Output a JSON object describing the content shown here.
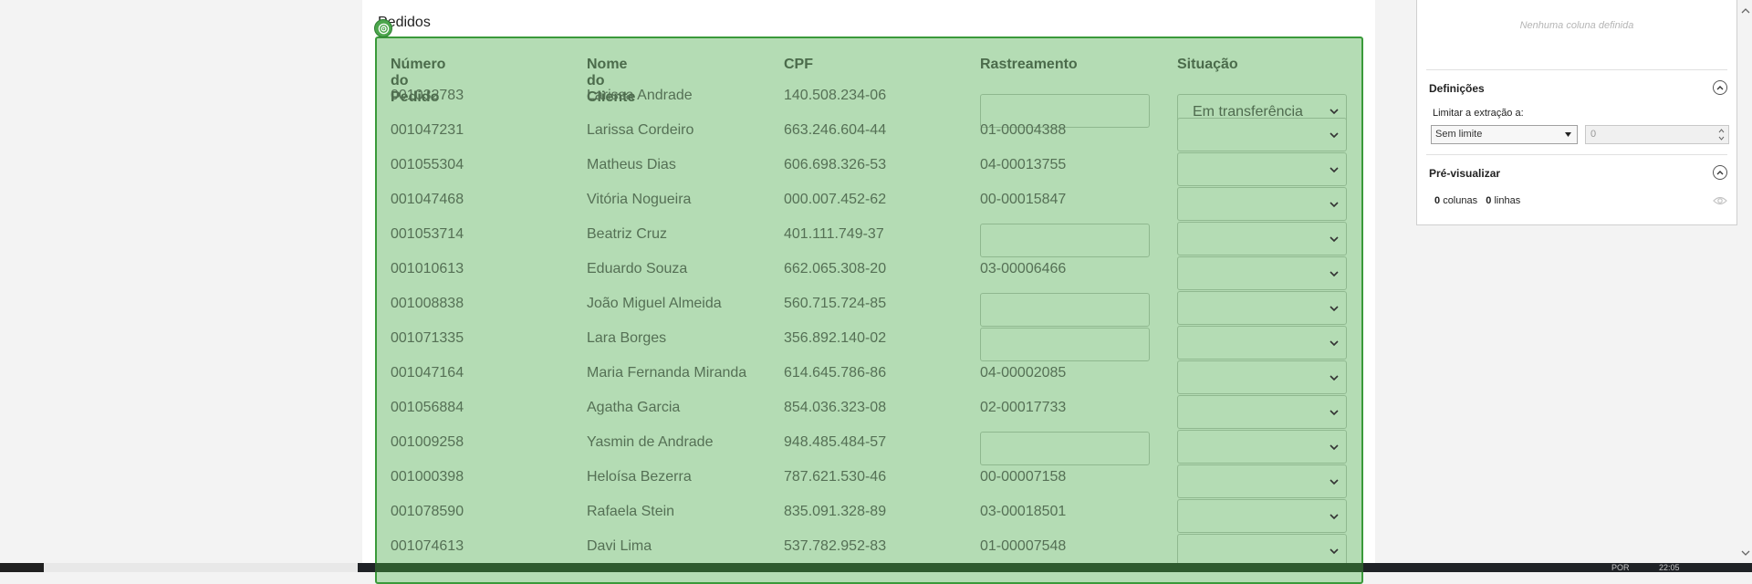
{
  "section": {
    "title": "Pedidos"
  },
  "table": {
    "headers": [
      "Número do Pedido",
      "Nome do Cliente",
      "CPF",
      "Rastreamento",
      "Situação"
    ],
    "rows": [
      {
        "order": "001032783",
        "client": "Larissa Andrade",
        "cpf": "140.508.234-06",
        "tracking": "",
        "status": "Em transferência"
      },
      {
        "order": "001047231",
        "client": "Larissa Cordeiro",
        "cpf": "663.246.604-44",
        "tracking": "01-00004388",
        "status": ""
      },
      {
        "order": "001055304",
        "client": "Matheus Dias",
        "cpf": "606.698.326-53",
        "tracking": "04-00013755",
        "status": ""
      },
      {
        "order": "001047468",
        "client": "Vitória Nogueira",
        "cpf": "000.007.452-62",
        "tracking": "00-00015847",
        "status": ""
      },
      {
        "order": "001053714",
        "client": "Beatriz Cruz",
        "cpf": "401.111.749-37",
        "tracking": "",
        "status": ""
      },
      {
        "order": "001010613",
        "client": "Eduardo Souza",
        "cpf": "662.065.308-20",
        "tracking": "03-00006466",
        "status": ""
      },
      {
        "order": "001008838",
        "client": "João Miguel Almeida",
        "cpf": "560.715.724-85",
        "tracking": "",
        "status": ""
      },
      {
        "order": "001071335",
        "client": "Lara Borges",
        "cpf": "356.892.140-02",
        "tracking": "",
        "status": ""
      },
      {
        "order": "001047164",
        "client": "Maria Fernanda Miranda",
        "cpf": "614.645.786-86",
        "tracking": "04-00002085",
        "status": ""
      },
      {
        "order": "001056884",
        "client": "Agatha Garcia",
        "cpf": "854.036.323-08",
        "tracking": "02-00017733",
        "status": ""
      },
      {
        "order": "001009258",
        "client": "Yasmin de Andrade",
        "cpf": "948.485.484-57",
        "tracking": "",
        "status": ""
      },
      {
        "order": "001000398",
        "client": "Heloísa Bezerra",
        "cpf": "787.621.530-46",
        "tracking": "00-00007158",
        "status": ""
      },
      {
        "order": "001078590",
        "client": "Rafaela Stein",
        "cpf": "835.091.328-89",
        "tracking": "03-00018501",
        "status": ""
      },
      {
        "order": "001074613",
        "client": "Davi Lima",
        "cpf": "537.782.952-83",
        "tracking": "01-00007548",
        "status": ""
      }
    ]
  },
  "side_panel": {
    "empty_columns_text": "Nenhuma coluna definida",
    "definitions_title": "Definições",
    "limit_label": "Limitar a extração a:",
    "limit_option": "Sem limite",
    "limit_value": "0",
    "preview_title": "Pré-visualizar",
    "columns_count": "0",
    "columns_word": "colunas",
    "rows_count": "0",
    "rows_word": "linhas"
  },
  "taskbar": {
    "lang": "POR",
    "time": "22:05"
  },
  "colors": {
    "highlight": "#b4dcb4",
    "highlight_border": "#3a9a3a",
    "badge": "#4ca64c"
  },
  "icons": [
    "target-icon",
    "chevron-down-icon",
    "chevron-up-icon",
    "eye-icon",
    "spinner-icon"
  ]
}
